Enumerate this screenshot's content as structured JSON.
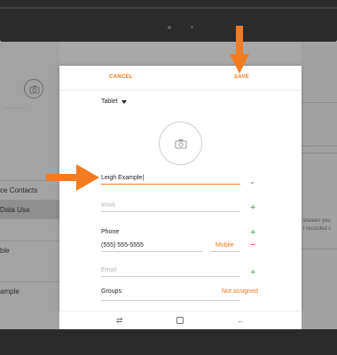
{
  "background": {
    "left_rows": [
      {
        "label": "ce Contacts",
        "selected": false
      },
      {
        "label": "Data Usa",
        "selected": true
      },
      {
        "label": "ble",
        "selected": false
      },
      {
        "label": "ample",
        "selected": false
      }
    ],
    "right_text": [
      "etween you",
      "l recorded c"
    ]
  },
  "dialog": {
    "cancel_label": "CANCEL",
    "save_label": "SAVE",
    "account": "Tablet",
    "name_value": "Leigh Example",
    "work_placeholder": "Work",
    "phone_label": "Phone",
    "phone_value": "(555) 555-5555",
    "phone_type": "Mobile",
    "email_placeholder": "Email",
    "groups_label": "Groups",
    "groups_value": "Not assigned"
  },
  "colors": {
    "accent": "#f47b20",
    "add": "#43a047",
    "remove": "#e53935"
  },
  "icons": {
    "photo": "camera-icon",
    "expand": "chevron-down-icon",
    "add": "plus-icon",
    "remove": "minus-icon"
  }
}
